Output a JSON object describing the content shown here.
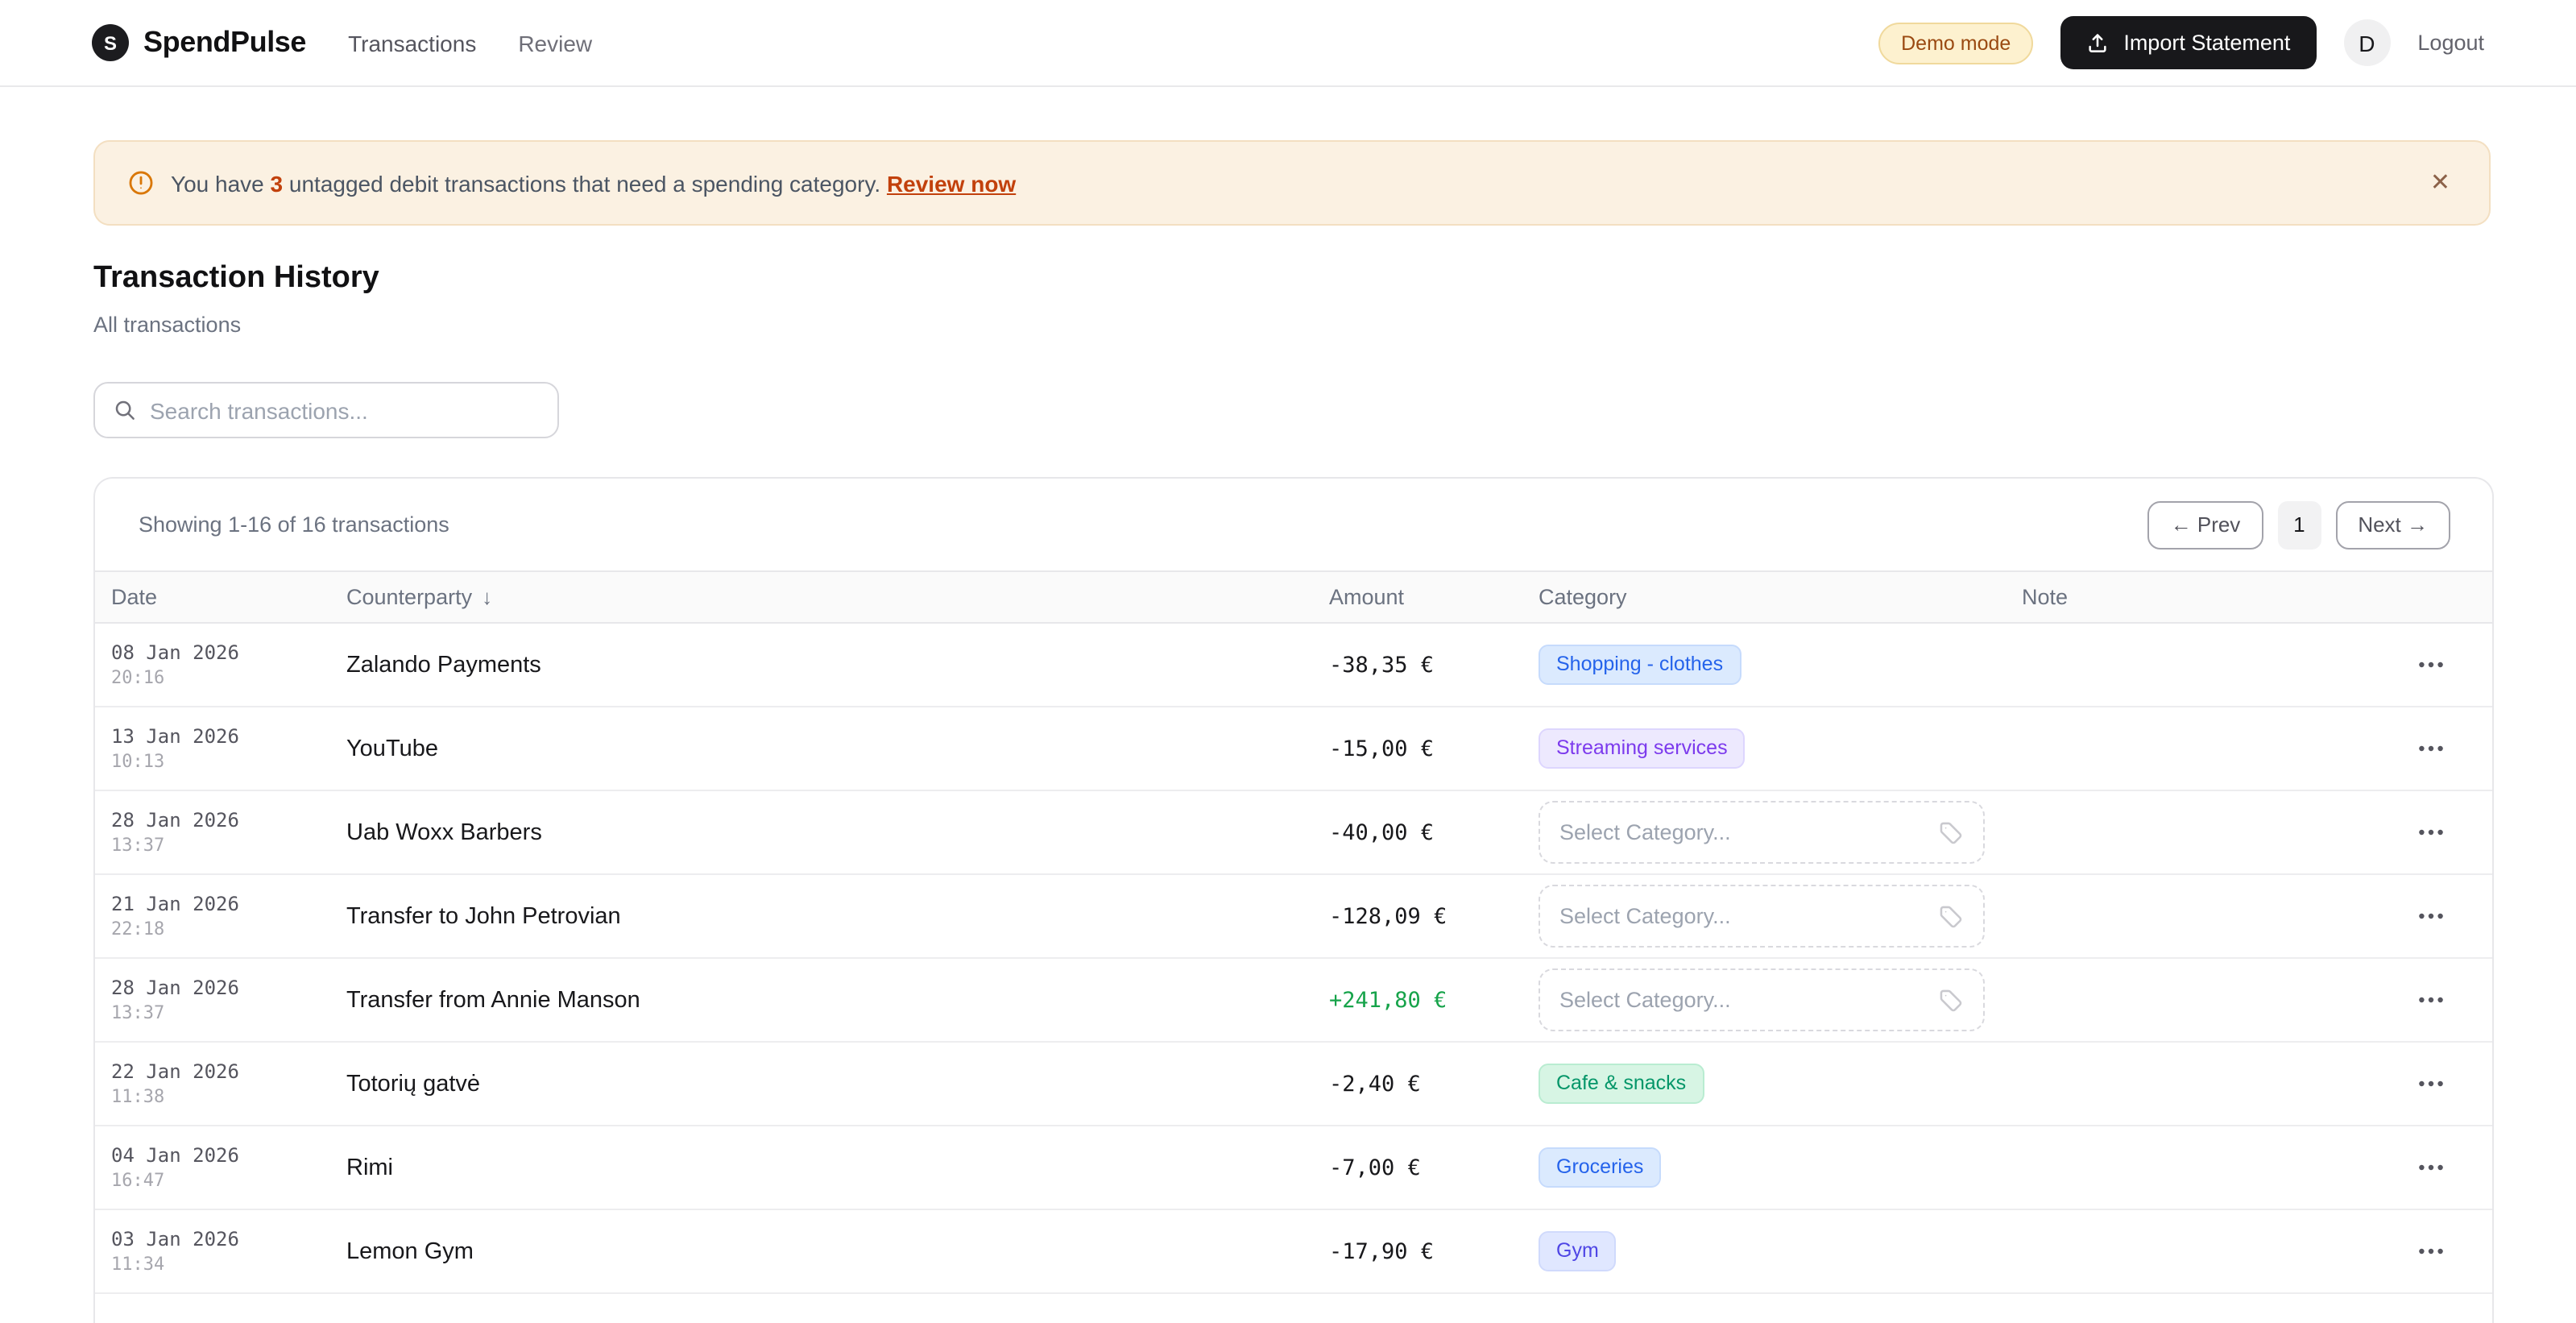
{
  "header": {
    "logo_initial": "S",
    "app_name": "SpendPulse",
    "nav": {
      "transactions": "Transactions",
      "review": "Review"
    },
    "demo_badge": "Demo mode",
    "import_button": "Import Statement",
    "avatar_initial": "D",
    "logout": "Logout"
  },
  "alert": {
    "prefix": "You have ",
    "count": "3",
    "suffix": " untagged debit transactions that need a spending category. ",
    "link": "Review now",
    "close": "✕"
  },
  "page": {
    "title": "Transaction History",
    "subtitle": "All transactions"
  },
  "search": {
    "placeholder": "Search transactions..."
  },
  "table": {
    "summary": "Showing 1-16 of 16 transactions",
    "pagination": {
      "prev": "← Prev",
      "page": "1",
      "next": "Next →"
    },
    "columns": {
      "date": "Date",
      "counterparty": "Counterparty",
      "sort_indicator": "↓",
      "amount": "Amount",
      "category": "Category",
      "note": "Note"
    },
    "select_placeholder": "Select Category...",
    "rows": [
      {
        "date": "08 Jan 2026",
        "time": "20:16",
        "counterparty": "Zalando Payments",
        "amount": "-38,35 €",
        "category": {
          "type": "chip",
          "label": "Shopping - clothes",
          "color": "blue"
        },
        "note": ""
      },
      {
        "date": "13 Jan 2026",
        "time": "10:13",
        "counterparty": "YouTube",
        "amount": "-15,00 €",
        "category": {
          "type": "chip",
          "label": "Streaming services",
          "color": "purple"
        },
        "note": ""
      },
      {
        "date": "28 Jan 2026",
        "time": "13:37",
        "counterparty": "Uab Woxx Barbers",
        "amount": "-40,00 €",
        "category": {
          "type": "select"
        },
        "note": ""
      },
      {
        "date": "21 Jan 2026",
        "time": "22:18",
        "counterparty": "Transfer to John Petrovian",
        "amount": "-128,09 €",
        "category": {
          "type": "select"
        },
        "note": ""
      },
      {
        "date": "28 Jan 2026",
        "time": "13:37",
        "counterparty": "Transfer from Annie Manson",
        "amount": "+241,80 €",
        "category": {
          "type": "select"
        },
        "note": ""
      },
      {
        "date": "22 Jan 2026",
        "time": "11:38",
        "counterparty": "Totorių gatvė",
        "amount": "-2,40 €",
        "category": {
          "type": "chip",
          "label": "Cafe & snacks",
          "color": "green"
        },
        "note": ""
      },
      {
        "date": "04 Jan 2026",
        "time": "16:47",
        "counterparty": "Rimi",
        "amount": "-7,00 €",
        "category": {
          "type": "chip",
          "label": "Groceries",
          "color": "blue"
        },
        "note": ""
      },
      {
        "date": "03 Jan 2026",
        "time": "11:34",
        "counterparty": "Lemon Gym",
        "amount": "-17,90 €",
        "category": {
          "type": "chip",
          "label": "Gym",
          "color": "indigo"
        },
        "note": ""
      }
    ]
  },
  "colors": {
    "accent_orange": "#c2410c",
    "alert_bg": "#fbf1e2",
    "credit_green": "#16a34a",
    "chip_blue": "#2563eb",
    "chip_purple": "#7c3aed",
    "chip_green": "#059669",
    "chip_indigo": "#4f46e5",
    "dark_button": "#18181b"
  }
}
